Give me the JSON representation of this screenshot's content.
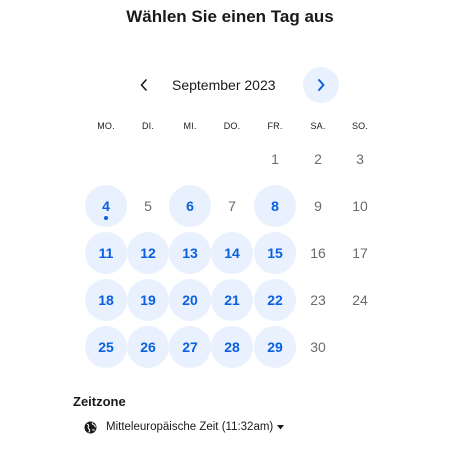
{
  "title": "Wählen Sie einen Tag aus",
  "calendar": {
    "month_label": "September 2023",
    "prev_icon": "chevron-left-icon",
    "next_icon": "chevron-right-icon",
    "weekdays": [
      "MO.",
      "DI.",
      "MI.",
      "DO.",
      "FR.",
      "SA.",
      "SO."
    ],
    "weeks": [
      [
        {
          "day": ""
        },
        {
          "day": ""
        },
        {
          "day": ""
        },
        {
          "day": ""
        },
        {
          "day": "1",
          "available": false
        },
        {
          "day": "2",
          "available": false
        },
        {
          "day": "3",
          "available": false
        }
      ],
      [
        {
          "day": "4",
          "available": true,
          "today": true
        },
        {
          "day": "5",
          "available": false
        },
        {
          "day": "6",
          "available": true
        },
        {
          "day": "7",
          "available": false
        },
        {
          "day": "8",
          "available": true
        },
        {
          "day": "9",
          "available": false
        },
        {
          "day": "10",
          "available": false
        }
      ],
      [
        {
          "day": "11",
          "available": true
        },
        {
          "day": "12",
          "available": true
        },
        {
          "day": "13",
          "available": true
        },
        {
          "day": "14",
          "available": true
        },
        {
          "day": "15",
          "available": true
        },
        {
          "day": "16",
          "available": false
        },
        {
          "day": "17",
          "available": false
        }
      ],
      [
        {
          "day": "18",
          "available": true
        },
        {
          "day": "19",
          "available": true
        },
        {
          "day": "20",
          "available": true
        },
        {
          "day": "21",
          "available": true
        },
        {
          "day": "22",
          "available": true
        },
        {
          "day": "23",
          "available": false
        },
        {
          "day": "24",
          "available": false
        }
      ],
      [
        {
          "day": "25",
          "available": true
        },
        {
          "day": "26",
          "available": true
        },
        {
          "day": "27",
          "available": true
        },
        {
          "day": "28",
          "available": true
        },
        {
          "day": "29",
          "available": true
        },
        {
          "day": "30",
          "available": false
        },
        {
          "day": ""
        }
      ]
    ]
  },
  "timezone": {
    "heading": "Zeitzone",
    "value": "Mitteleuropäische Zeit (11:32am)",
    "icon": "globe-icon",
    "dropdown_icon": "caret-down-icon"
  },
  "colors": {
    "accent": "#0a60e0",
    "available_bg": "#e8f1fd",
    "text": "#1a1a1a",
    "muted": "#6b6b6b"
  }
}
